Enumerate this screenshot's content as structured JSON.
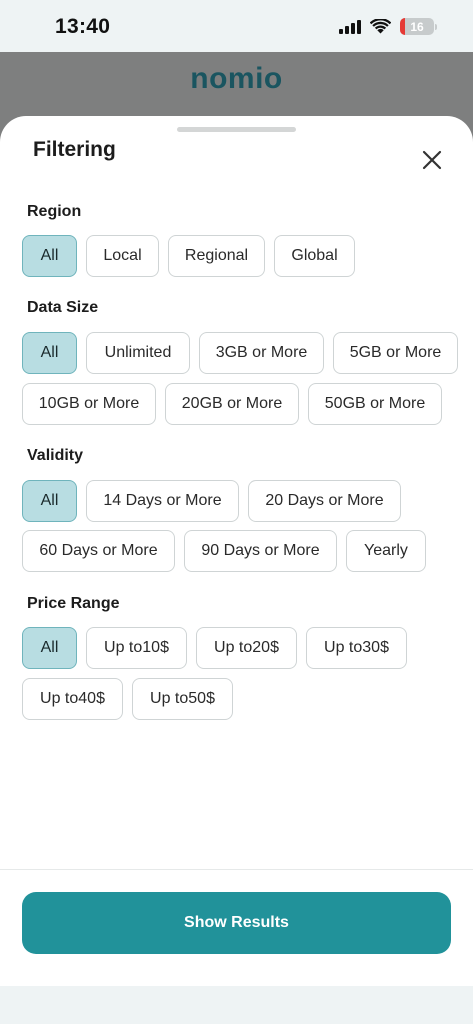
{
  "status_bar": {
    "time": "13:40",
    "battery_level": "16"
  },
  "header": {
    "logo_text": "nomio"
  },
  "sheet": {
    "title": "Filtering",
    "sections": [
      {
        "label": "Region",
        "options": [
          "All",
          "Local",
          "Regional",
          "Global"
        ],
        "selected": "All"
      },
      {
        "label": "Data Size",
        "options": [
          "All",
          "Unlimited",
          "3GB or More",
          "5GB or More",
          "10GB or More",
          "20GB or More",
          "50GB or More"
        ],
        "selected": "All"
      },
      {
        "label": "Validity",
        "options": [
          "All",
          "14 Days or More",
          "20 Days or More",
          "60 Days or More",
          "90 Days or More",
          "Yearly"
        ],
        "selected": "All"
      },
      {
        "label": "Price Range",
        "options": [
          "All",
          "Up to10$",
          "Up to20$",
          "Up to30$",
          "Up to40$",
          "Up to50$"
        ],
        "selected": "All"
      }
    ],
    "submit_label": "Show Results"
  },
  "colors": {
    "accent": "#21929a",
    "chip_selected_bg": "#b8dde2",
    "logo": "#1a5560"
  }
}
